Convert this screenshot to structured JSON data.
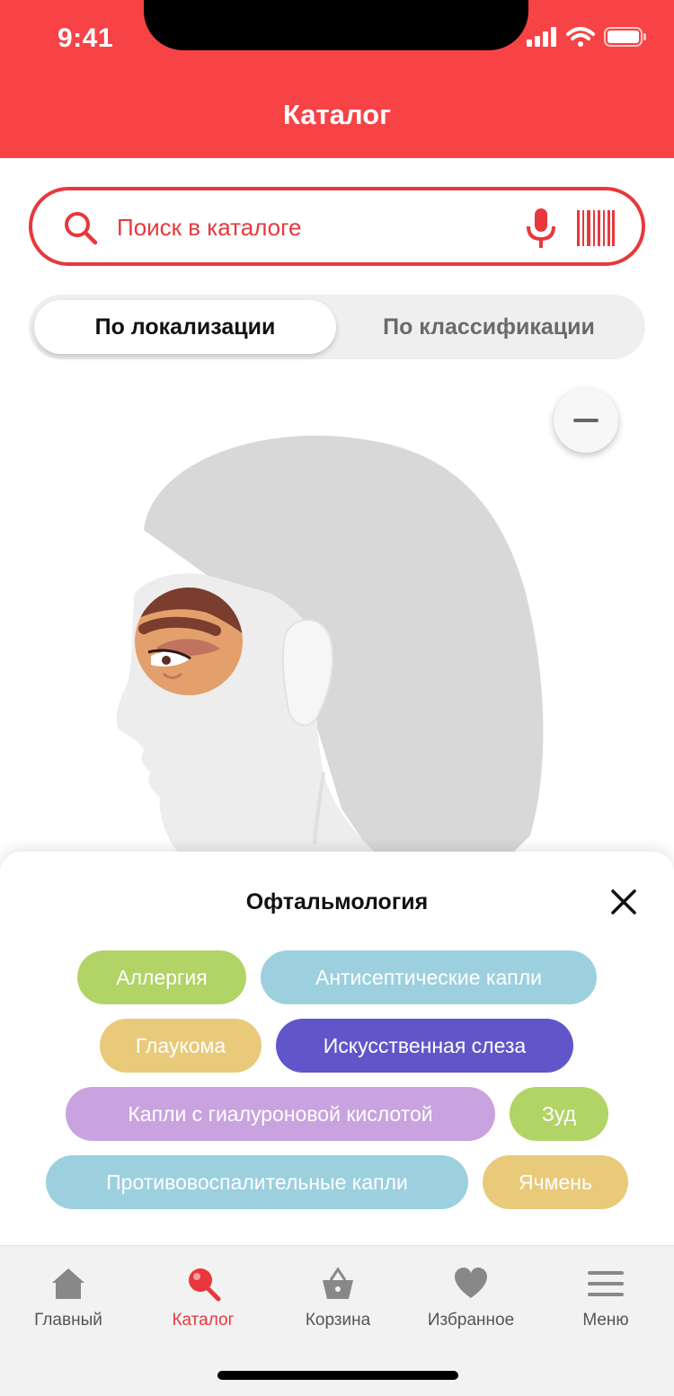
{
  "status_bar": {
    "time": "9:41"
  },
  "header": {
    "title": "Каталог"
  },
  "search": {
    "placeholder": "Поиск в каталоге"
  },
  "segments": [
    {
      "label": "По локализации",
      "active": true
    },
    {
      "label": "По классификации",
      "active": false
    }
  ],
  "icons": {
    "search": "search-icon",
    "mic": "microphone-icon",
    "barcode": "barcode-icon",
    "zoom_out": "minus-icon",
    "close": "close-icon"
  },
  "sheet": {
    "title": "Офтальмология",
    "chips": [
      {
        "label": "Аллергия",
        "color": "#B2D366"
      },
      {
        "label": "Антисептические капли",
        "color": "#9DD0DF"
      },
      {
        "label": "Глаукома",
        "color": "#E8CA7A"
      },
      {
        "label": "Искусственная слеза",
        "color": "#6156C9"
      },
      {
        "label": "Капли с гиалуроновой кислотой",
        "color": "#C9A3DF"
      },
      {
        "label": "Зуд",
        "color": "#B2D366"
      },
      {
        "label": "Противовоспалительные капли",
        "color": "#9DD0DF"
      },
      {
        "label": "Ячмень",
        "color": "#E8CA7A"
      }
    ]
  },
  "tabbar": {
    "items": [
      {
        "label": "Главный",
        "icon": "home-icon",
        "active": false
      },
      {
        "label": "Каталог",
        "icon": "catalog-search-icon",
        "active": true
      },
      {
        "label": "Корзина",
        "icon": "basket-icon",
        "active": false
      },
      {
        "label": "Избранное",
        "icon": "heart-icon",
        "active": false
      },
      {
        "label": "Меню",
        "icon": "menu-icon",
        "active": false
      }
    ]
  },
  "colors": {
    "brand_red": "#F74246",
    "accent_red": "#E8383D",
    "tab_inactive": "#888888"
  }
}
